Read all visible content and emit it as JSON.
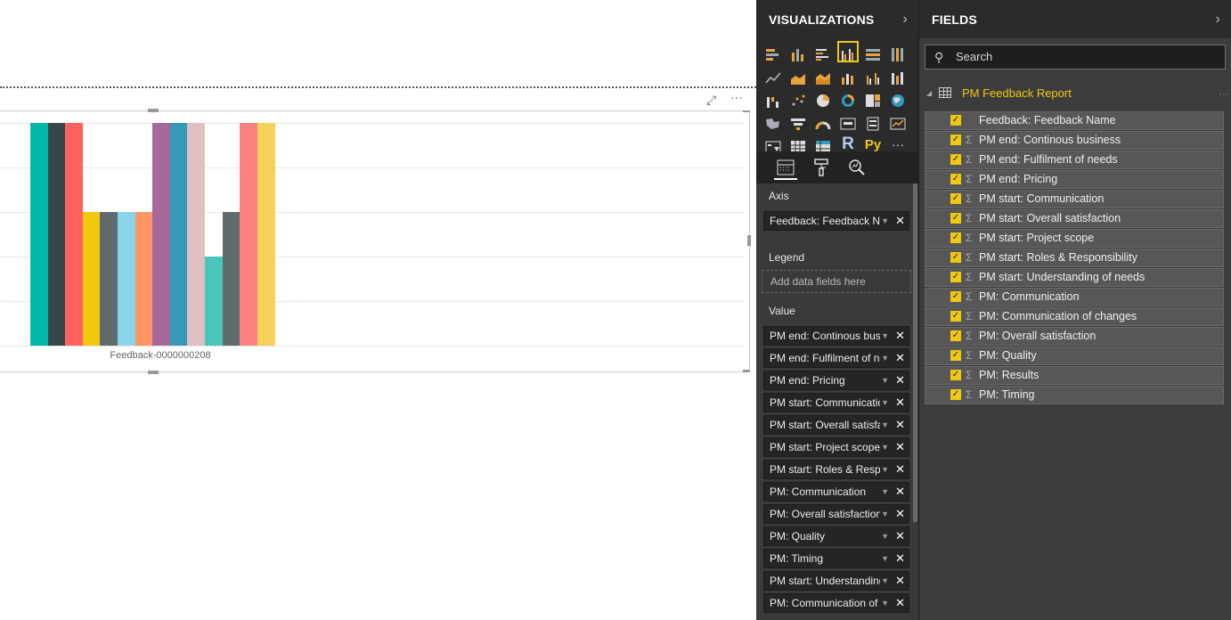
{
  "chart_data": {
    "type": "bar",
    "categories": [
      "Feedback-0000000208"
    ],
    "series": [
      {
        "values": [
          5
        ],
        "color": "#01B8AA"
      },
      {
        "values": [
          5
        ],
        "color": "#374649"
      },
      {
        "values": [
          5
        ],
        "color": "#FD625E"
      },
      {
        "values": [
          3
        ],
        "color": "#F2C80F"
      },
      {
        "values": [
          3
        ],
        "color": "#5F6B6D"
      },
      {
        "values": [
          3
        ],
        "color": "#8AD4EB"
      },
      {
        "values": [
          3
        ],
        "color": "#FE9666"
      },
      {
        "values": [
          5
        ],
        "color": "#A66999"
      },
      {
        "values": [
          5
        ],
        "color": "#3599B8"
      },
      {
        "values": [
          5
        ],
        "color": "#DFBFBF"
      },
      {
        "values": [
          2
        ],
        "color": "#4AC5BB"
      },
      {
        "values": [
          3
        ],
        "color": "#5F6B6D"
      },
      {
        "values": [
          5
        ],
        "color": "#FB8281"
      },
      {
        "values": [
          5
        ],
        "color": "#F4D25A"
      }
    ],
    "ylim": [
      0,
      5
    ],
    "grid": true,
    "legend": "none"
  },
  "visualizations": {
    "title": "VISUALIZATIONS",
    "axis_label": "Axis",
    "legend_label": "Legend",
    "value_label": "Value",
    "axis_field": "Feedback: Feedback Name",
    "legend_placeholder": "Add data fields here",
    "value_fields": [
      "PM end: Continous business",
      "PM end: Fulfilment of needs",
      "PM end: Pricing",
      "PM start: Communication",
      "PM start: Overall satisfaction",
      "PM start: Project scope",
      "PM start: Roles & Responsibility",
      "PM: Communication",
      "PM: Overall satisfaction",
      "PM: Quality",
      "PM: Timing",
      "PM start: Understanding of needs",
      "PM: Communication of changes"
    ],
    "r_label": "R",
    "py_label": "Py",
    "more_label": "···"
  },
  "fields": {
    "title": "FIELDS",
    "search_placeholder": "Search",
    "table_name": "PM Feedback Report",
    "items": [
      {
        "name": "Feedback: Feedback Name",
        "sigma": ""
      },
      {
        "name": "PM end: Continous business",
        "sigma": "Σ"
      },
      {
        "name": "PM end: Fulfilment of needs",
        "sigma": "Σ"
      },
      {
        "name": "PM end: Pricing",
        "sigma": "Σ"
      },
      {
        "name": "PM start: Communication",
        "sigma": "Σ"
      },
      {
        "name": "PM start: Overall satisfaction",
        "sigma": "Σ"
      },
      {
        "name": "PM start: Project scope",
        "sigma": "Σ"
      },
      {
        "name": "PM start: Roles & Responsibility",
        "sigma": "Σ"
      },
      {
        "name": "PM start: Understanding of needs",
        "sigma": "Σ"
      },
      {
        "name": "PM: Communication",
        "sigma": "Σ"
      },
      {
        "name": "PM: Communication of changes",
        "sigma": "Σ"
      },
      {
        "name": "PM: Overall satisfaction",
        "sigma": "Σ"
      },
      {
        "name": "PM: Quality",
        "sigma": "Σ"
      },
      {
        "name": "PM: Results",
        "sigma": "Σ"
      },
      {
        "name": "PM: Timing",
        "sigma": "Σ"
      }
    ]
  }
}
